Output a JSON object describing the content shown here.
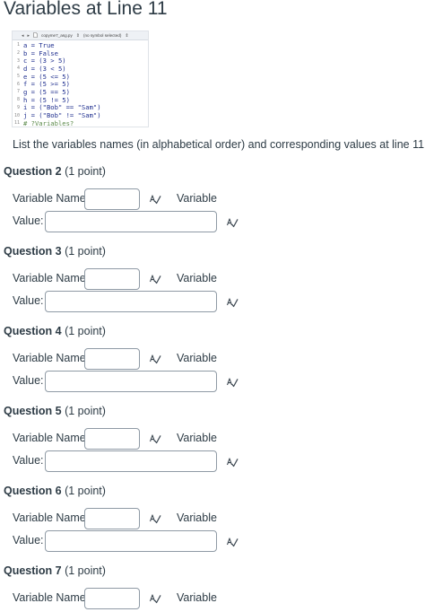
{
  "page": {
    "title": "Variables at Line 11"
  },
  "code_panel": {
    "toolbar": {
      "nav_back": "◂",
      "nav_forward": "▸",
      "filename": "copyme7_asg.py",
      "symbol": "(no symbol selected)",
      "symbol_arrow": "⇕",
      "file_arrow": "⇕"
    },
    "lines": [
      {
        "num": "1",
        "text": "a = True"
      },
      {
        "num": "2",
        "text": "b = False"
      },
      {
        "num": "3",
        "text": "c = (3 > 5)"
      },
      {
        "num": "4",
        "text": "d = (3 < 5)"
      },
      {
        "num": "5",
        "text": "e = (5 <= 5)"
      },
      {
        "num": "6",
        "text": "f = (5 >= 5)"
      },
      {
        "num": "7",
        "text": "g = (5 == 5)"
      },
      {
        "num": "8",
        "text": "h = (5 != 5)"
      },
      {
        "num": "9",
        "text": "i = (\"Bob\" == \"Sam\")"
      },
      {
        "num": "10",
        "text": "j = (\"Bob\" != \"Sam\")"
      },
      {
        "num": "11",
        "text": "# ?Variables?"
      }
    ]
  },
  "instructions": "List the variables names (in alphabetical order) and corresponding values at line 11.",
  "labels": {
    "variable_name": "Variable Name:",
    "value": "Value:",
    "variable_suffix": "Variable"
  },
  "questions": [
    {
      "title": "Question 2",
      "points": "(1 point)",
      "name_value": "",
      "value_value": ""
    },
    {
      "title": "Question 3",
      "points": "(1 point)",
      "name_value": "",
      "value_value": ""
    },
    {
      "title": "Question 4",
      "points": "(1 point)",
      "name_value": "",
      "value_value": ""
    },
    {
      "title": "Question 5",
      "points": "(1 point)",
      "name_value": "",
      "value_value": ""
    },
    {
      "title": "Question 6",
      "points": "(1 point)",
      "name_value": "",
      "value_value": ""
    },
    {
      "title": "Question 7",
      "points": "(1 point)",
      "name_value": "",
      "value_value": ""
    }
  ],
  "icons": {
    "field_check": "spellcheck-icon"
  },
  "colors": {
    "text": "#2d3b45",
    "input_border": "#8f9aa5",
    "code_keyword": "#1f2f8f",
    "code_comment": "#5b8a4a"
  }
}
